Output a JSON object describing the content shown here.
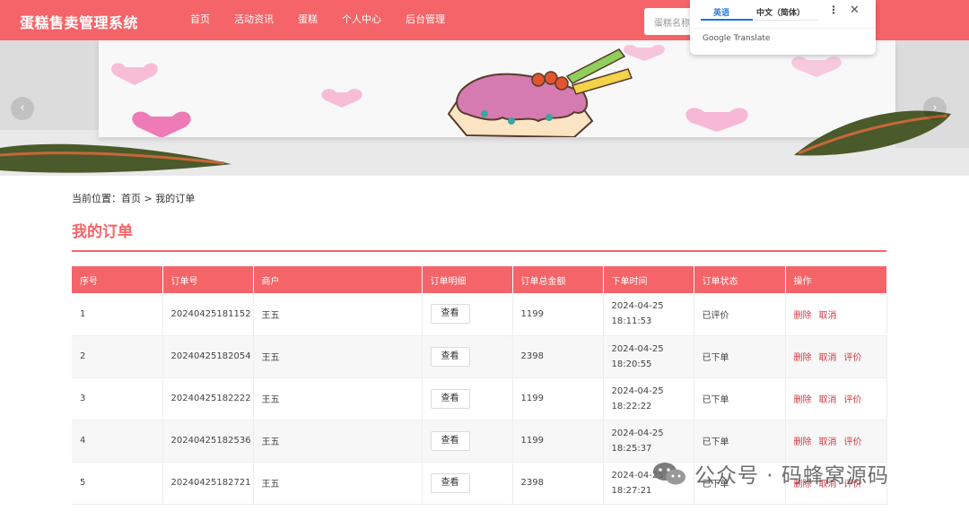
{
  "header": {
    "brand": "蛋糕售卖管理系统",
    "nav": [
      "首页",
      "活动资讯",
      "蛋糕",
      "个人中心",
      "后台管理"
    ],
    "search_placeholder": "蛋糕名称"
  },
  "translate_popup": {
    "tab_source": "英语",
    "tab_target": "中文（简体）",
    "more_icon": "⋮",
    "close_icon": "✕",
    "brand": "Google Translate"
  },
  "banner": {
    "prev_icon": "‹",
    "next_icon": "›"
  },
  "breadcrumb": "当前位置：首页 > 我的订单",
  "page_title": "我的订单",
  "table": {
    "headers": [
      "序号",
      "订单号",
      "商户",
      "订单明细",
      "订单总金额",
      "下单时间",
      "订单状态",
      "操作"
    ],
    "view_label": "查看",
    "rows": [
      {
        "index": "1",
        "order_no": "20240425181152",
        "merchant": "王五",
        "total": "1199",
        "time": "2024-04-25 18:11:53",
        "status": "已评价",
        "actions": [
          "删除",
          "取消"
        ]
      },
      {
        "index": "2",
        "order_no": "20240425182054",
        "merchant": "王五",
        "total": "2398",
        "time": "2024-04-25 18:20:55",
        "status": "已下单",
        "actions": [
          "删除",
          "取消",
          "评价"
        ]
      },
      {
        "index": "3",
        "order_no": "20240425182222",
        "merchant": "王五",
        "total": "1199",
        "time": "2024-04-25 18:22:22",
        "status": "已下单",
        "actions": [
          "删除",
          "取消",
          "评价"
        ]
      },
      {
        "index": "4",
        "order_no": "20240425182536",
        "merchant": "王五",
        "total": "1199",
        "time": "2024-04-25 18:25:37",
        "status": "已下单",
        "actions": [
          "删除",
          "取消",
          "评价"
        ]
      },
      {
        "index": "5",
        "order_no": "20240425182721",
        "merchant": "王五",
        "total": "2398",
        "time": "2024-04-25 18:27:21",
        "status": "已下单",
        "actions": [
          "删除",
          "取消",
          "评价"
        ]
      }
    ]
  },
  "watermark": "公众号 · 码蜂窝源码",
  "colors": {
    "accent": "#f56468",
    "action": "#d9363e"
  }
}
